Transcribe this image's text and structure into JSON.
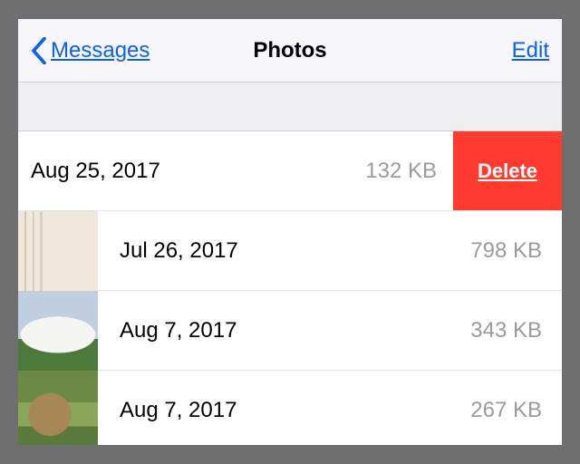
{
  "nav": {
    "back_label": "Messages",
    "title": "Photos",
    "edit_label": "Edit"
  },
  "rows": [
    {
      "date": "Aug 25, 2017",
      "size": "132 KB",
      "swiped": true,
      "thumb": null,
      "delete_label": "Delete"
    },
    {
      "date": "Jul 26, 2017",
      "size": "798 KB",
      "swiped": false,
      "thumb": "doc"
    },
    {
      "date": "Aug 7, 2017",
      "size": "343 KB",
      "swiped": false,
      "thumb": "dome"
    },
    {
      "date": "Aug 7, 2017",
      "size": "267 KB",
      "swiped": false,
      "thumb": "pangolin"
    }
  ]
}
